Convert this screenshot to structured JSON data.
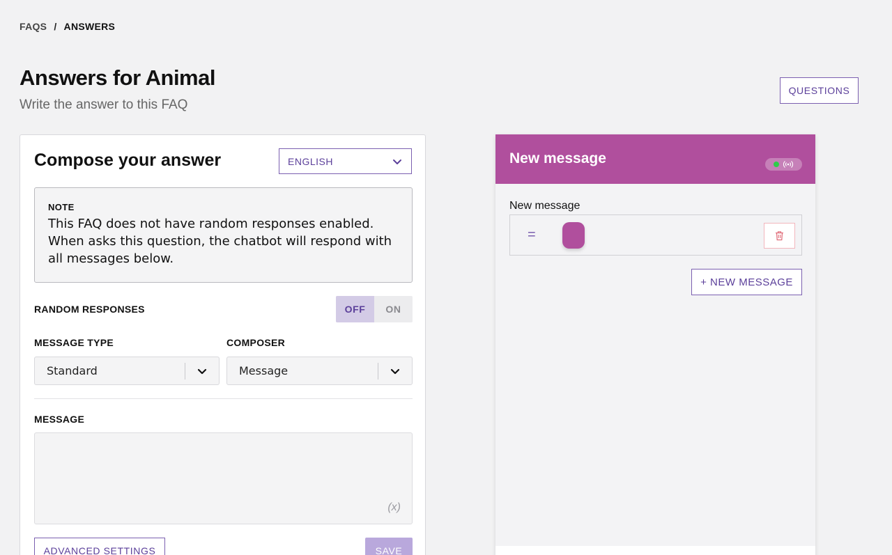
{
  "breadcrumb": {
    "parent": "FAQS",
    "separator": "/",
    "current": "ANSWERS"
  },
  "header": {
    "title": "Answers for Animal",
    "subtitle": "Write the answer to this FAQ",
    "questions_button": "QUESTIONS"
  },
  "compose": {
    "title": "Compose your answer",
    "language": {
      "selected": "ENGLISH",
      "icon": "chevron-down-icon"
    },
    "note": {
      "label": "NOTE",
      "line1": "This FAQ does not have random responses enabled.",
      "line2": "When asks this question, the chatbot will respond with",
      "line3": "all messages below."
    },
    "random_responses": {
      "label": "RANDOM RESPONSES",
      "off": "OFF",
      "on": "ON",
      "state": "OFF"
    },
    "message_type": {
      "label": "MESSAGE TYPE",
      "value": "Standard"
    },
    "composer": {
      "label": "COMPOSER",
      "value": "Message"
    },
    "message": {
      "label": "MESSAGE",
      "value": "",
      "variable_icon": "(x)"
    },
    "advanced_button": "ADVANCED SETTINGS",
    "save_button": "SAVE"
  },
  "preview": {
    "header_title": "New message",
    "status": {
      "online": true,
      "icon": "broadcast-icon"
    },
    "message_label": "New message",
    "drag_handle": "=",
    "new_message_button": "+ NEW MESSAGE"
  },
  "colors": {
    "accent": "#5b3f9a",
    "brand_magenta": "#b04f9d",
    "status_green": "#2fcc4a",
    "delete_red": "#e06b78"
  }
}
